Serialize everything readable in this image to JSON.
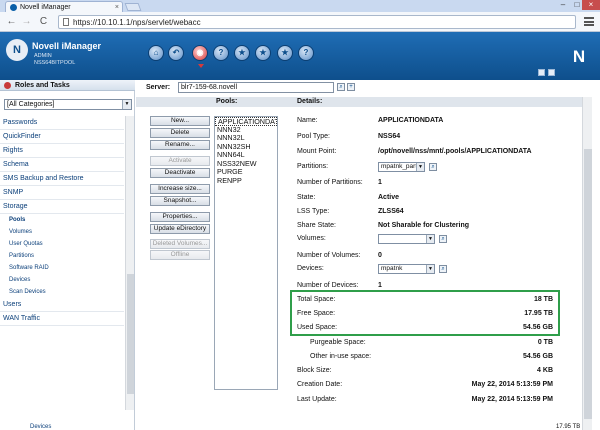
{
  "browser": {
    "tab_title": "Novell iManager",
    "tab_close": "×",
    "url": "https://10.10.1.1/nps/servlet/webacc",
    "back": "←",
    "forward": "→",
    "reload": "C"
  },
  "window": {
    "minimize": "–",
    "maximize": "□",
    "close": "×"
  },
  "header": {
    "logo": "N",
    "app_title": "Novell iManager",
    "user": "ADMIN",
    "tree": "NSS64BITPOOL",
    "brand": "N"
  },
  "toolbar": {
    "home": "⌂",
    "back": "↶",
    "roles": "◉",
    "search": "?",
    "favorites": "★",
    "configure": "★",
    "help": "?"
  },
  "left": {
    "title": "Roles and Tasks",
    "category": "[All Categories]",
    "items": [
      {
        "label": "Passwords",
        "sub": false
      },
      {
        "label": "QuickFinder",
        "sub": false
      },
      {
        "label": "Rights",
        "sub": false
      },
      {
        "label": "Schema",
        "sub": false
      },
      {
        "label": "SMS Backup and Restore",
        "sub": false
      },
      {
        "label": "SNMP",
        "sub": false
      },
      {
        "label": "Storage",
        "sub": false
      },
      {
        "label": "Pools",
        "sub": true,
        "sel": true
      },
      {
        "label": "Volumes",
        "sub": true
      },
      {
        "label": "User Quotas",
        "sub": true
      },
      {
        "label": "Partitions",
        "sub": true
      },
      {
        "label": "Software RAID",
        "sub": true
      },
      {
        "label": "Devices",
        "sub": true
      },
      {
        "label": "Scan Devices",
        "sub": true
      },
      {
        "label": "Users",
        "sub": false
      },
      {
        "label": "WAN Traffic",
        "sub": false
      }
    ]
  },
  "server": {
    "label": "Server:",
    "value": "blr7-159-68.novell"
  },
  "pools": {
    "label": "Pools:",
    "items": [
      "APPLICATIONDATA",
      "NNN32",
      "NNN32L",
      "NNN32SH",
      "NNN64L",
      "NSS32NEW",
      "PURGE",
      "RENPP"
    ]
  },
  "buttons": [
    {
      "label": "New...",
      "disabled": false
    },
    {
      "label": "Delete",
      "disabled": false
    },
    {
      "label": "Rename...",
      "disabled": false
    },
    {
      "label": "Activate",
      "disabled": true
    },
    {
      "label": "Deactivate",
      "disabled": false
    },
    {
      "label": "Increase size...",
      "disabled": false
    },
    {
      "label": "Snapshot...",
      "disabled": false
    },
    {
      "label": "Properties...",
      "disabled": false
    },
    {
      "label": "Update eDirectory",
      "disabled": false
    },
    {
      "label": "Deleted Volumes...",
      "disabled": true
    },
    {
      "label": "Offline",
      "disabled": true
    }
  ],
  "details": {
    "label": "Details:",
    "name": {
      "label": "Name:",
      "value": "APPLICATIONDATA"
    },
    "pool_type": {
      "label": "Pool Type:",
      "value": "NSS64"
    },
    "mount_point": {
      "label": "Mount Point:",
      "value": "/opt/novell/nss/mnt/.pools/APPLICATIONDATA"
    },
    "partitions": {
      "label": "Partitions:",
      "value": "mpatnk_part"
    },
    "num_partitions": {
      "label": "Number of Partitions:",
      "value": "1"
    },
    "state": {
      "label": "State:",
      "value": "Active"
    },
    "lss_type": {
      "label": "LSS Type:",
      "value": "ZLSS64"
    },
    "share_state": {
      "label": "Share State:",
      "value": "Not Sharable for Clustering"
    },
    "volumes": {
      "label": "Volumes:",
      "value": ""
    },
    "num_volumes": {
      "label": "Number of Volumes:",
      "value": "0"
    },
    "devices": {
      "label": "Devices:",
      "value": "mpatnk"
    },
    "num_devices": {
      "label": "Number of Devices:",
      "value": "1"
    },
    "total_space": {
      "label": "Total Space:",
      "value": "18 TB"
    },
    "free_space": {
      "label": "Free Space:",
      "value": "17.95 TB"
    },
    "used_space": {
      "label": "Used Space:",
      "value": "54.56 GB"
    },
    "purgeable_space": {
      "label": "Purgeable Space:",
      "value": "0 TB"
    },
    "other_inuse": {
      "label": "Other in-use space:",
      "value": "54.56 GB"
    },
    "block_size": {
      "label": "Block Size:",
      "value": "4 KB"
    },
    "creation_date": {
      "label": "Creation Date:",
      "value": "May 22, 2014 5:13:59 PM"
    },
    "last_update": {
      "label": "Last Update:",
      "value": "May 22, 2014 5:13:59 PM"
    }
  },
  "footer": {
    "cut_left": "Devices",
    "cut_right": "17.95 TB"
  },
  "icon_glyphs": {
    "dropdown": "▼",
    "lookup": "⌕",
    "plus": "+"
  },
  "colors": {
    "header": "#1466b0",
    "highlight_box": "#2f9e4a",
    "link": "#0b3f7a"
  }
}
